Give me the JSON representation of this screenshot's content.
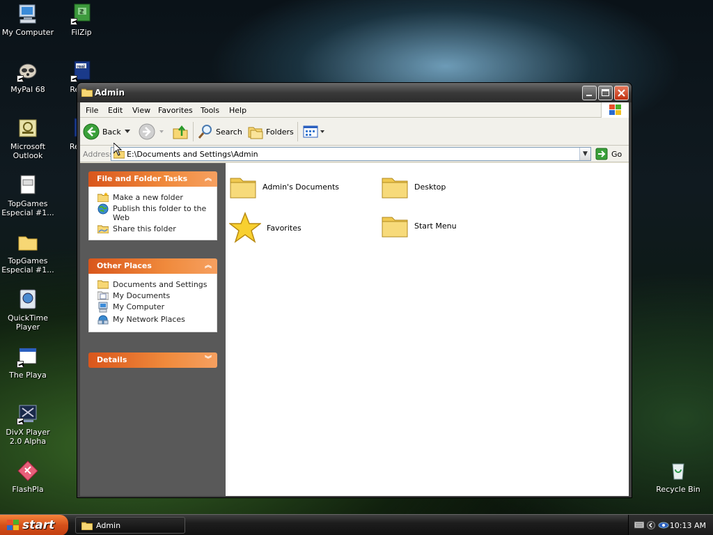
{
  "desktop": {
    "icons": [
      {
        "label": "My Computer"
      },
      {
        "label": "FilZip"
      },
      {
        "label": "MyPal 68"
      },
      {
        "label": "Real.c"
      },
      {
        "label": "Microsoft Outlook"
      },
      {
        "label": "Real E"
      },
      {
        "label": "TopGames Especial #1..."
      },
      {
        "label": "TopGames Especial #1..."
      },
      {
        "label": "QuickTime Player"
      },
      {
        "label": "The Playa"
      },
      {
        "label": "DivX Player 2.0 Alpha"
      },
      {
        "label": "FlashPla"
      },
      {
        "label": "Recycle Bin"
      }
    ]
  },
  "window": {
    "title": "Admin",
    "menu": [
      "File",
      "Edit",
      "View",
      "Favorites",
      "Tools",
      "Help"
    ],
    "toolbar": {
      "back_label": "Back",
      "search_label": "Search",
      "folders_label": "Folders"
    },
    "address": {
      "label": "Address",
      "value": "E:\\Documents and Settings\\Admin",
      "go_label": "Go"
    },
    "tasks": {
      "file_folder": {
        "title": "File and Folder Tasks",
        "items": [
          "Make a new folder",
          "Publish this folder to the Web",
          "Share this folder"
        ]
      },
      "other_places": {
        "title": "Other Places",
        "items": [
          "Documents and Settings",
          "My Documents",
          "My Computer",
          "My Network Places"
        ]
      },
      "details": {
        "title": "Details"
      }
    },
    "contents": [
      {
        "label": "Admin's Documents",
        "icon": "folder-icon"
      },
      {
        "label": "Desktop",
        "icon": "folder-icon"
      },
      {
        "label": "Favorites",
        "icon": "star-icon"
      },
      {
        "label": "Start Menu",
        "icon": "folder-icon"
      }
    ]
  },
  "taskbar": {
    "start_label": "start",
    "task_label": "Admin",
    "clock": "10:13 AM"
  },
  "colors": {
    "task_header": "#e8702a",
    "start_button": "#d4501a",
    "window_frame": "#404040"
  }
}
